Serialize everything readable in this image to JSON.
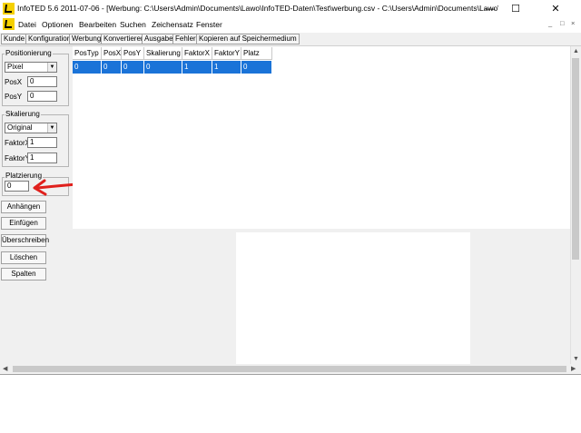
{
  "window": {
    "title": "InfoTED 5.6 2011-07-06  - [Werbung: C:\\Users\\Admin\\Documents\\Lawo\\InfoTED-Daten\\Test\\werbung.csv - C:\\Users\\Admin\\Documents\\Lawo\\InfoTED-Da...",
    "minimize": "—",
    "maximize": "☐",
    "close": "✕"
  },
  "menubar": {
    "items": [
      "Datei",
      "Optionen",
      "Bearbeiten",
      "Suchen",
      "Zeichensatz",
      "Fenster"
    ],
    "mdi_controls": [
      "_",
      "□",
      "×"
    ]
  },
  "toolbar": {
    "buttons": [
      "Kunde",
      "Konfiguration",
      "Werbung",
      "Konvertieren",
      "Ausgabe",
      "Fehler",
      "Kopieren auf Speichermedium"
    ]
  },
  "positionierung": {
    "title": "Positionierung",
    "mode": "Pixel",
    "posx_label": "PosX",
    "posx_value": "0",
    "posy_label": "PosY",
    "posy_value": "0"
  },
  "skalierung": {
    "title": "Skalierung",
    "mode": "Original",
    "faktorx_label": "FaktorX",
    "faktorx_value": "1",
    "faktory_label": "FaktorY",
    "faktory_value": "1"
  },
  "platzierung": {
    "title": "Platzierung",
    "value": "0"
  },
  "actions": [
    "Anhängen",
    "Einfügen",
    "Überschreiben",
    "Löschen",
    "Spalten"
  ],
  "table": {
    "columns": [
      "PosTyp",
      "PosX",
      "PosY",
      "Skalierung",
      "FaktorX",
      "FaktorY",
      "Platz"
    ],
    "rows": [
      [
        "0",
        "0",
        "0",
        "0",
        "1",
        "1",
        "0"
      ]
    ]
  },
  "colors": {
    "selection": "#1a73d8",
    "annotation_arrow": "#e0201c"
  },
  "icons": {
    "app": "lawo-l-logo-icon",
    "dropdown": "chevron-down-icon",
    "scroll_up": "arrow-up-icon",
    "scroll_down": "arrow-down-icon",
    "scroll_left": "arrow-left-icon",
    "scroll_right": "arrow-right-icon"
  }
}
